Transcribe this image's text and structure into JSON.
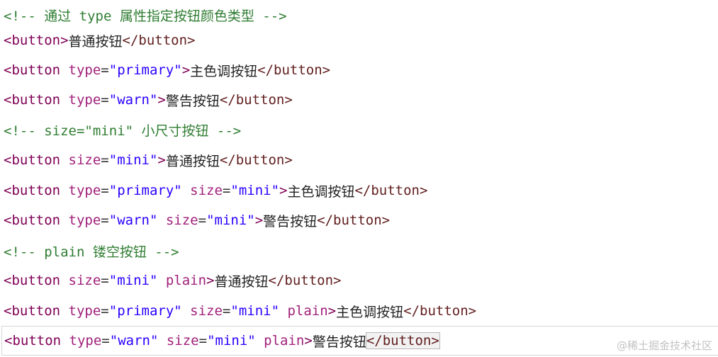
{
  "lines": [
    {
      "kind": "comment",
      "text": "<!-- 通过 type 属性指定按钮颜色类型 -->"
    },
    {
      "kind": "code",
      "open": "<button",
      "attrs": [],
      "close": ">",
      "content": "普通按钮",
      "end": "</button>"
    },
    {
      "kind": "code",
      "open": "<button",
      "attrs": [
        {
          "name": "type",
          "value": "\"primary\""
        }
      ],
      "close": ">",
      "content": "主色调按钮",
      "end": "</button>"
    },
    {
      "kind": "code",
      "open": "<button",
      "attrs": [
        {
          "name": "type",
          "value": "\"warn\""
        }
      ],
      "close": ">",
      "content": "警告按钮",
      "end": "</button>"
    },
    {
      "kind": "comment",
      "text": "<!-- size=\"mini\" 小尺寸按钮 -->"
    },
    {
      "kind": "code",
      "open": "<button",
      "attrs": [
        {
          "name": "size",
          "value": "\"mini\""
        }
      ],
      "close": ">",
      "content": "普通按钮",
      "end": "</button>"
    },
    {
      "kind": "code",
      "open": "<button",
      "attrs": [
        {
          "name": "type",
          "value": "\"primary\""
        },
        {
          "name": "size",
          "value": "\"mini\""
        }
      ],
      "close": ">",
      "content": "主色调按钮",
      "end": "</button>"
    },
    {
      "kind": "code",
      "open": "<button",
      "attrs": [
        {
          "name": "type",
          "value": "\"warn\""
        },
        {
          "name": "size",
          "value": "\"mini\""
        }
      ],
      "close": ">",
      "content": "警告按钮",
      "end": "</button>"
    },
    {
      "kind": "comment",
      "text": "<!-- plain 镂空按钮 -->"
    },
    {
      "kind": "code",
      "open": "<button",
      "attrs": [
        {
          "name": "size",
          "value": "\"mini\""
        },
        {
          "name": "plain"
        }
      ],
      "close": ">",
      "content": "普通按钮",
      "end": "</button>"
    },
    {
      "kind": "code",
      "open": "<button",
      "attrs": [
        {
          "name": "type",
          "value": "\"primary\""
        },
        {
          "name": "size",
          "value": "\"mini\""
        },
        {
          "name": "plain"
        }
      ],
      "close": ">",
      "content": "主色调按钮",
      "end": "</button>"
    },
    {
      "kind": "code",
      "open": "<button",
      "attrs": [
        {
          "name": "type",
          "value": "\"warn\""
        },
        {
          "name": "size",
          "value": "\"mini\""
        },
        {
          "name": "plain"
        }
      ],
      "close": ">",
      "content": "警告按钮",
      "end": "</button>",
      "current": true
    }
  ],
  "watermark": "@稀土掘金技术社区",
  "colors": {
    "tag": "#7f0055",
    "attribute": "#a0207a",
    "value": "#2a00ff",
    "comment": "#2f7d32",
    "text": "#222222"
  }
}
